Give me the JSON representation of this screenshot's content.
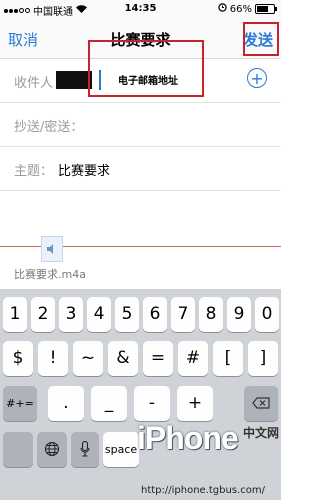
{
  "status_bar": {
    "carrier": "中国联通",
    "time": "14:35",
    "battery": "66%"
  },
  "nav": {
    "cancel": "取消",
    "title": "比赛要求",
    "send": "发送"
  },
  "fields": {
    "to_label": "收件人",
    "email_annotation": "电子邮箱地址",
    "add_icon": "+",
    "cc_label": "抄送/密送：",
    "subject_label": "主题：",
    "subject_value": "比赛要求"
  },
  "attachment": {
    "name": "比赛要求.m4a"
  },
  "keyboard": {
    "row1": [
      "1",
      "2",
      "3",
      "4",
      "5",
      "6",
      "7",
      "8",
      "9",
      "0"
    ],
    "row2": [
      "$",
      "!",
      "~",
      "&",
      "=",
      "#",
      "[",
      "]"
    ],
    "row3_left": "#+=",
    "row3": [
      ".",
      "_",
      "-",
      "+"
    ],
    "row4_space": "space"
  },
  "watermark": {
    "text": "iPhone",
    "sub": "中文网",
    "url": "http://iphone.tgbus.com/"
  }
}
